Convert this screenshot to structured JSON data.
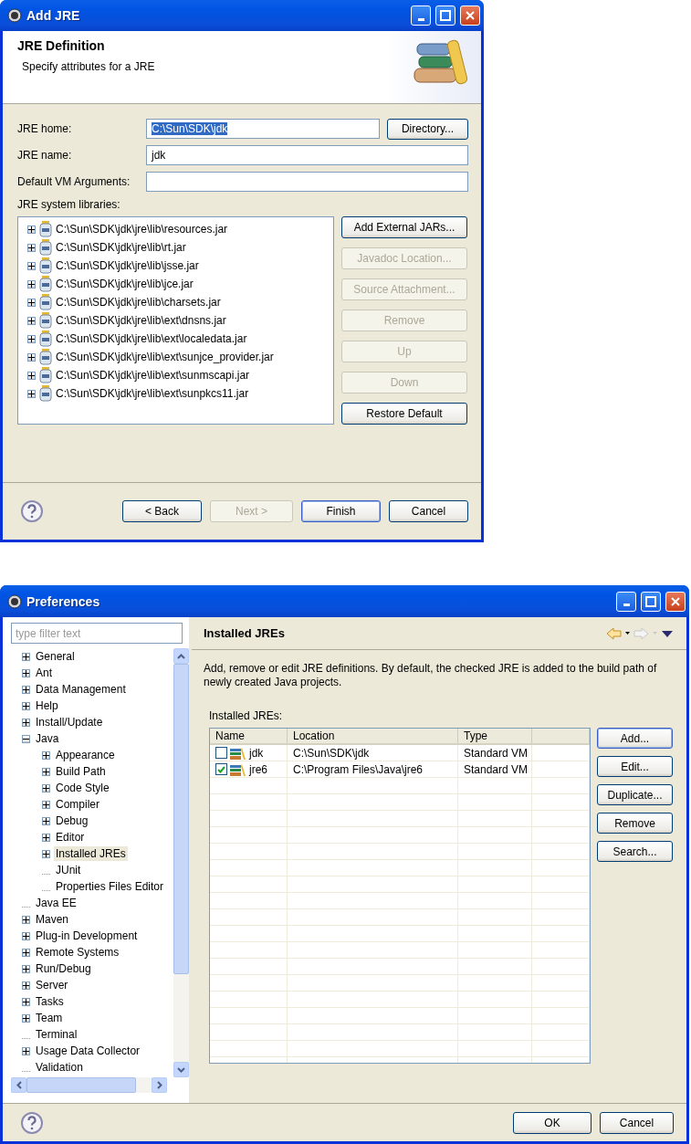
{
  "add_jre": {
    "title": "Add JRE",
    "header": {
      "title": "JRE Definition",
      "description": "Specify attributes for a JRE"
    },
    "fields": [
      {
        "label": "JRE home:",
        "value": "C:\\Sun\\SDK\\jdk",
        "text_selected": true,
        "button": "Directory..."
      },
      {
        "label": "JRE name:",
        "value": "jdk",
        "text_selected": false
      },
      {
        "label": "Default VM Arguments:"
      }
    ],
    "libraries_label": "JRE system libraries:",
    "libraries": [
      {
        "path": "C:\\Sun\\SDK\\jdk\\jre\\lib\\resources.jar",
        "expanded": false
      },
      {
        "path": "C:\\Sun\\SDK\\jdk\\jre\\lib\\rt.jar",
        "expanded": false
      },
      {
        "path": "C:\\Sun\\SDK\\jdk\\jre\\lib\\jsse.jar",
        "expanded": false
      },
      {
        "path": "C:\\Sun\\SDK\\jdk\\jre\\lib\\jce.jar",
        "expanded": false
      },
      {
        "path": "C:\\Sun\\SDK\\jdk\\jre\\lib\\charsets.jar",
        "expanded": false
      },
      {
        "path": "C:\\Sun\\SDK\\jdk\\jre\\lib\\ext\\dnsns.jar",
        "expanded": false
      },
      {
        "path": "C:\\Sun\\SDK\\jdk\\jre\\lib\\ext\\localedata.jar",
        "expanded": false
      },
      {
        "path": "C:\\Sun\\SDK\\jdk\\jre\\lib\\ext\\sunjce_provider.jar",
        "expanded": false
      },
      {
        "path": "C:\\Sun\\SDK\\jdk\\jre\\lib\\ext\\sunmscapi.jar",
        "expanded": false
      },
      {
        "path": "C:\\Sun\\SDK\\jdk\\jre\\lib\\ext\\sunpkcs11.jar",
        "expanded": false
      }
    ],
    "side_buttons": [
      {
        "label": "Add External JARs...",
        "disabled": false
      },
      {
        "label": "Javadoc Location...",
        "disabled": true
      },
      {
        "label": "Source Attachment...",
        "disabled": true
      },
      {
        "label": "Remove",
        "disabled": true
      },
      {
        "label": "Up",
        "disabled": true
      },
      {
        "label": "Down",
        "disabled": true
      },
      {
        "label": "Restore Default",
        "disabled": false
      }
    ],
    "footer_buttons": [
      {
        "label": "< Back",
        "disabled": false,
        "default": false
      },
      {
        "label": "Next >",
        "disabled": true,
        "default": false
      },
      {
        "label": "Finish",
        "disabled": false,
        "default": true
      },
      {
        "label": "Cancel",
        "disabled": false,
        "default": false
      }
    ]
  },
  "preferences": {
    "title": "Preferences",
    "filter": {
      "placeholder": "type filter text"
    },
    "tree": [
      {
        "label": "General",
        "expanded": false,
        "selected": false
      },
      {
        "label": "Ant",
        "expanded": false,
        "selected": false
      },
      {
        "label": "Data Management",
        "expanded": false,
        "selected": false
      },
      {
        "label": "Help",
        "expanded": false,
        "selected": false
      },
      {
        "label": "Install/Update",
        "expanded": false,
        "selected": false
      },
      {
        "label": "Java",
        "expanded": true,
        "selected": false,
        "children": [
          {
            "label": "Appearance",
            "expanded": false,
            "selected": false
          },
          {
            "label": "Build Path",
            "expanded": false,
            "selected": false
          },
          {
            "label": "Code Style",
            "expanded": false,
            "selected": false
          },
          {
            "label": "Compiler",
            "expanded": false,
            "selected": false
          },
          {
            "label": "Debug",
            "expanded": false,
            "selected": false
          },
          {
            "label": "Editor",
            "expanded": false,
            "selected": false
          },
          {
            "label": "Installed JREs",
            "expanded": false,
            "selected": true
          },
          {
            "label": "JUnit",
            "selected": false
          },
          {
            "label": "Properties Files Editor",
            "selected": false
          }
        ]
      },
      {
        "label": "Java EE",
        "selected": false
      },
      {
        "label": "Maven",
        "expanded": false,
        "selected": false
      },
      {
        "label": "Plug-in Development",
        "expanded": false,
        "selected": false
      },
      {
        "label": "Remote Systems",
        "expanded": false,
        "selected": false
      },
      {
        "label": "Run/Debug",
        "expanded": false,
        "selected": false
      },
      {
        "label": "Server",
        "expanded": false,
        "selected": false
      },
      {
        "label": "Tasks",
        "expanded": false,
        "selected": false
      },
      {
        "label": "Team",
        "expanded": false,
        "selected": false
      },
      {
        "label": "Terminal",
        "selected": false
      },
      {
        "label": "Usage Data Collector",
        "expanded": false,
        "selected": false
      },
      {
        "label": "Validation",
        "selected": false
      }
    ],
    "page_title": "Installed JREs",
    "description": "Add, remove or edit JRE definitions. By default, the checked JRE is added to the build path of newly created Java projects.",
    "table_label": "Installed JREs:",
    "columns": [
      "Name",
      "Location",
      "Type"
    ],
    "rows": [
      {
        "name": "jdk",
        "location": "C:\\Sun\\SDK\\jdk",
        "type": "Standard VM",
        "checked": false
      },
      {
        "name": "jre6",
        "location": "C:\\Program Files\\Java\\jre6",
        "type": "Standard VM",
        "checked": true
      }
    ],
    "side_buttons": [
      {
        "label": "Add...",
        "default": true
      },
      {
        "label": "Edit...",
        "default": false
      },
      {
        "label": "Duplicate...",
        "default": false
      },
      {
        "label": "Remove",
        "default": false
      },
      {
        "label": "Search...",
        "default": false
      }
    ],
    "footer_buttons": [
      {
        "label": "OK",
        "default": false
      },
      {
        "label": "Cancel",
        "default": false
      }
    ]
  }
}
